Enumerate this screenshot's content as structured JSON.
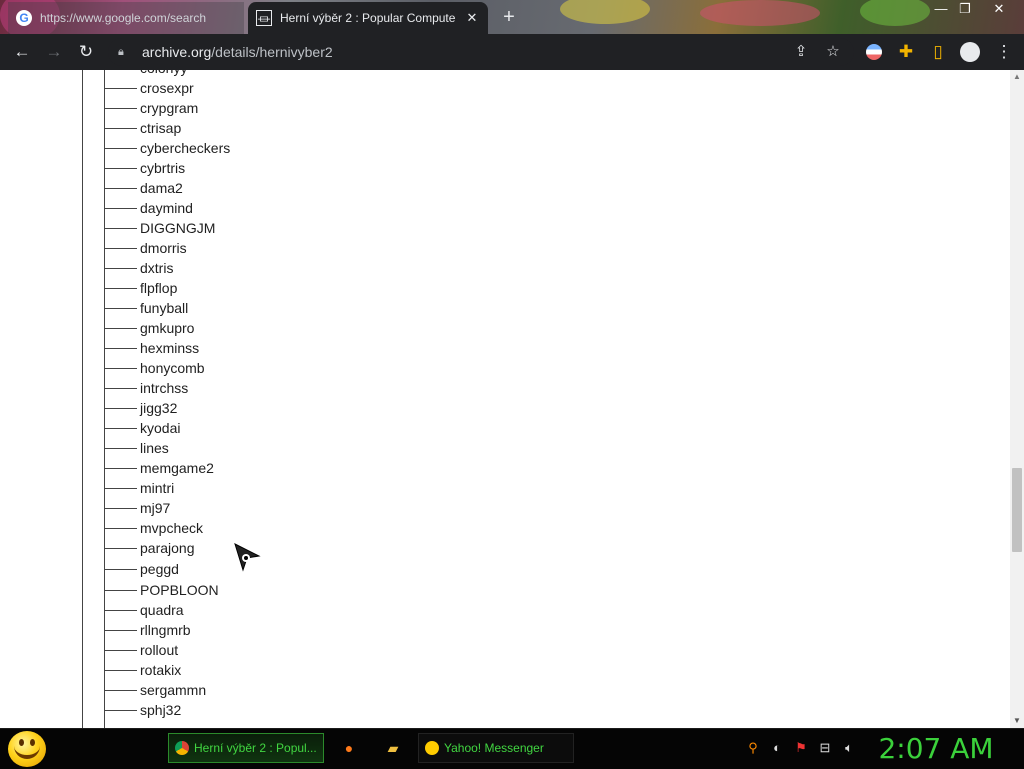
{
  "browser": {
    "tabs": [
      {
        "title": "https://www.google.com/search",
        "icon": "google-g-icon"
      },
      {
        "title": "Herní výběr 2 : Popular Compute",
        "icon": "archive-building-icon"
      }
    ],
    "new_tab_label": "+",
    "url_host": "archive.org",
    "url_path": "/details/hernivyber2"
  },
  "tree": {
    "partial_top_item": "colonyy",
    "items": [
      "crosexpr",
      "crypgram",
      "ctrisap",
      "cybercheckers",
      "cybrtris",
      "dama2",
      "daymind",
      "DIGGNGJM",
      "dmorris",
      "dxtris",
      "flpflop",
      "funyball",
      "gmkupro",
      "hexminss",
      "honycomb",
      "intrchss",
      "jigg32",
      "kyodai",
      "lines",
      "memgame2",
      "mintri",
      "mj97",
      "mvpcheck",
      "parajong",
      "peggd",
      "POPBLOON",
      "quadra",
      "rllngmrb",
      "rollout",
      "rotakix",
      "sergammn",
      "sphj32"
    ]
  },
  "taskbar": {
    "items": [
      {
        "label": "Herní výběr 2 : Popul...",
        "icon": "chrome-icon"
      },
      {
        "label": "Yahoo! Messenger",
        "icon": "yahoo-messenger-icon"
      }
    ],
    "clock": "2:07 AM"
  },
  "colors": {
    "toolbar": "#202124",
    "taskbar_text": "#41d641",
    "clock": "#3bd13b"
  }
}
